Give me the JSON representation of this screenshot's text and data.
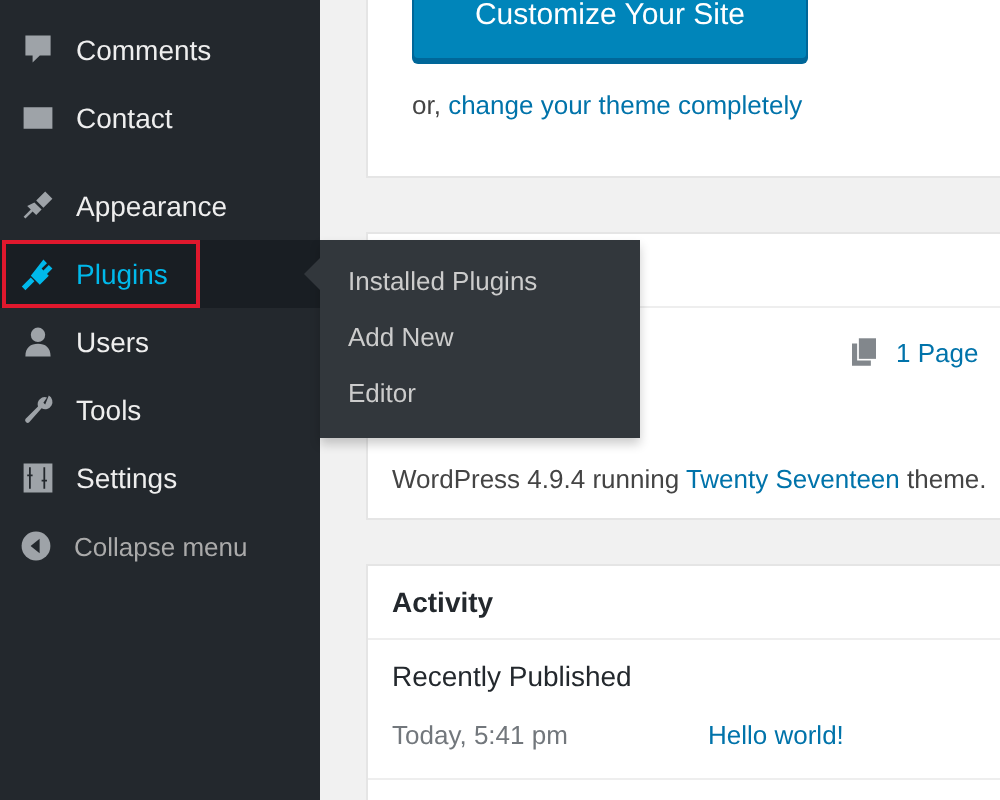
{
  "sidebar": {
    "groups": [
      {
        "items": [
          {
            "label": "Comments",
            "selected": false,
            "highlighted": false
          },
          {
            "label": "Contact",
            "selected": false,
            "highlighted": false
          }
        ]
      },
      {
        "items": [
          {
            "label": "Appearance",
            "selected": false,
            "highlighted": false
          },
          {
            "label": "Plugins",
            "selected": true,
            "highlighted": true
          },
          {
            "label": "Users",
            "selected": false,
            "highlighted": false
          },
          {
            "label": "Tools",
            "selected": false,
            "highlighted": false
          },
          {
            "label": "Settings",
            "selected": false,
            "highlighted": false
          }
        ]
      }
    ],
    "collapse": {
      "label": "Collapse menu"
    }
  },
  "flyout": {
    "items": [
      "Installed Plugins",
      "Add New",
      "Editor"
    ]
  },
  "welcome": {
    "button": "Customize Your Site",
    "text_prefix": "or,",
    "link": "change your theme completely"
  },
  "glance": {
    "count_link": "1 Page",
    "version_prefix": "WordPress 4.9.4 running",
    "theme_link": "Twenty Seventeen",
    "version_suffix": "theme."
  },
  "activity": {
    "title": "Activity",
    "section": "Recently Published",
    "posts": [
      {
        "date": "Today, 5:41 pm",
        "title": "Hello world!"
      }
    ]
  }
}
